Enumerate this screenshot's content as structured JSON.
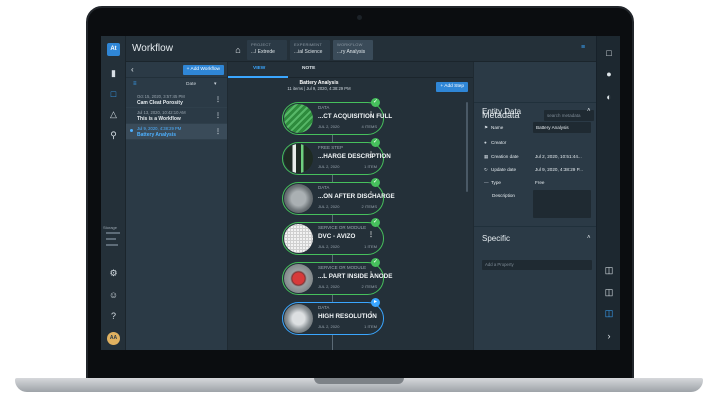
{
  "app": {
    "title": "Workflow",
    "logo": "At"
  },
  "breadcrumbs": [
    {
      "kind": "PROJECT",
      "value": "...l Extrede"
    },
    {
      "kind": "EXPERIMENT",
      "value": "...ial Science"
    },
    {
      "kind": "WORKFLOW",
      "value": "...ry Analysis"
    }
  ],
  "workflows": {
    "add_label": "+ Add Workflow",
    "sort_label": "Date",
    "items": [
      {
        "date": "Oct 15, 2020, 3:57:45 PM",
        "name": "Cam Cleat Porosity"
      },
      {
        "date": "Jul 13, 2020, 10:42:10 AM",
        "name": "This is a Workflow"
      },
      {
        "date": "Jul 9, 2020, 4:38:29 PM",
        "name": "Battery Analysis"
      }
    ]
  },
  "tabs": {
    "view": "VIEW",
    "note": "NOTE"
  },
  "analysis": {
    "name": "Battery Analysis",
    "meta": "11 items | Jul 9, 2020, 4:38:29 PM",
    "add_step": "+ Add Step"
  },
  "steps": [
    {
      "type": "DATA",
      "name": "...CT ACQUISITION FULL",
      "date": "JUL 2, 2020",
      "items": "4 ITEMS",
      "status": "green"
    },
    {
      "type": "FREE STEP",
      "name": "...HARGE DESCRIPTION",
      "date": "JUL 2, 2020",
      "items": "1 ITEM",
      "status": "green"
    },
    {
      "type": "DATA",
      "name": "...ON AFTER DISCHARGE",
      "date": "JUL 2, 2020",
      "items": "2 ITEMS",
      "status": "green"
    },
    {
      "type": "SERVICE OR MODULE",
      "name": "DVC - AVIZO",
      "date": "JUL 2, 2020",
      "items": "1 ITEM",
      "status": "green"
    },
    {
      "type": "SERVICE OR MODULE",
      "name": "...L PART INSIDE ANODE",
      "date": "JUL 2, 2020",
      "items": "2 ITEMS",
      "status": "green"
    },
    {
      "type": "DATA",
      "name": "HIGH RESOLUTION",
      "date": "JUL 2, 2020",
      "items": "1 ITEM",
      "status": "blue"
    }
  ],
  "metadata": {
    "title": "Metadata",
    "search_placeholder": "search metadata",
    "entity_title": "Entity Data",
    "fields": {
      "name_label": "Name",
      "name_value": "Battery Analysis",
      "creator_label": "Creator",
      "creation_label": "Creation date",
      "creation_value": "Jul 2, 2020, 10:51:44...",
      "update_label": "Update date",
      "update_value": "Jul 9, 2020, 4:38:29 P...",
      "type_label": "Type",
      "type_value": "Free",
      "desc_label": "Description"
    },
    "specific_title": "Specific",
    "add_property": "Add a Property"
  },
  "storage_label": "Storage",
  "avatar_initials": "AA",
  "colors": {
    "accent": "#2f86d6",
    "success": "#46c05c",
    "bg": "#2b3a46"
  }
}
